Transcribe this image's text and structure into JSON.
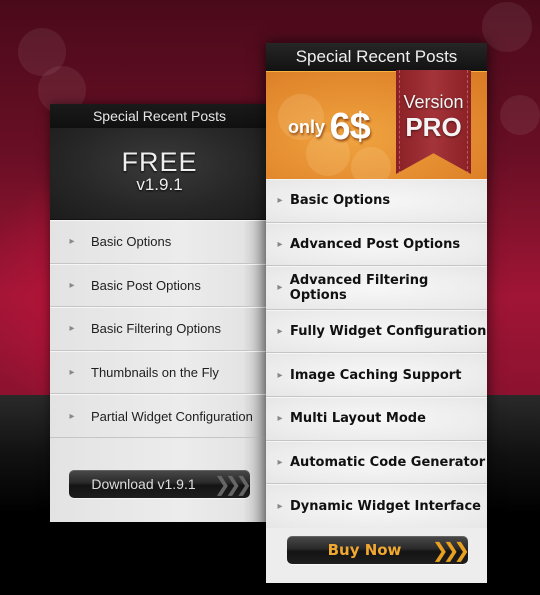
{
  "free_panel": {
    "title": "Special Recent Posts",
    "edition": "FREE",
    "version": "v1.9.1",
    "features": [
      "Basic Options",
      "Basic Post Options",
      "Basic Filtering Options",
      "Thumbnails on the Fly",
      "Partial Widget Configuration"
    ],
    "button_label": "Download v1.9.1",
    "button_icon": "triple-chevron-right-icon"
  },
  "pro_panel": {
    "title": "Special Recent Posts",
    "price_prefix": "only",
    "price": "6$",
    "ribbon_line1": "Version",
    "ribbon_line2": "PRO",
    "features": [
      "Basic Options",
      "Advanced Post Options",
      "Advanced Filtering Options",
      "Fully Widget Configuration",
      "Image Caching Support",
      "Multi Layout Mode",
      "Automatic Code Generator",
      "Dynamic Widget Interface"
    ],
    "button_label": "Buy Now",
    "button_icon": "triple-chevron-right-icon"
  },
  "icons": {
    "bullet": "▸",
    "chevrons": "❯❯❯"
  },
  "colors": {
    "background_top": "#a01535",
    "background_bottom": "#000000",
    "pro_accent": "#e48c30",
    "ribbon": "#8a2025",
    "buy_text": "#f0a830"
  }
}
